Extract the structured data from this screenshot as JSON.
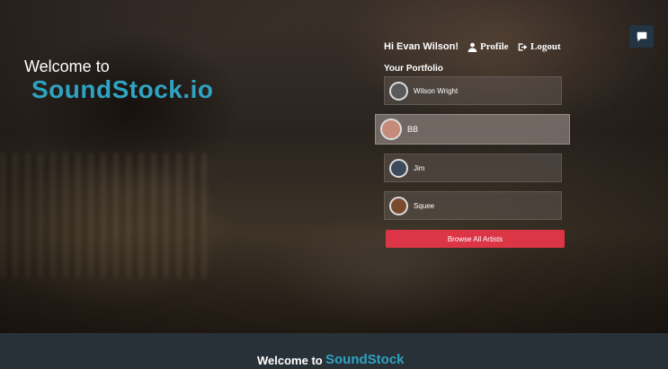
{
  "hero": {
    "welcome": "Welcome to",
    "brand": "SoundStock",
    "brand_tld": ".io"
  },
  "header": {
    "greeting": "Hi Evan Wilson!",
    "profile_label": "Profile",
    "logout_label": "Logout",
    "profile_icon": "user-icon",
    "logout_icon": "sign-out-icon",
    "chat_icon": "chat-icon"
  },
  "portfolio": {
    "label": "Your Portfolio",
    "artists": [
      {
        "name": "Wilson Wright",
        "avatar_color": "#5a5a5a"
      },
      {
        "name": "BB",
        "avatar_color": "#c58b78"
      },
      {
        "name": "Jim",
        "avatar_color": "#3e4a5c"
      },
      {
        "name": "Squee",
        "avatar_color": "#7a4a2e"
      }
    ],
    "browse_label": "Browse All Artists"
  },
  "footer": {
    "welcome": "Welcome to",
    "brand": "SoundStock"
  },
  "colors": {
    "accent": "#2fa3c2",
    "button": "#dc3545",
    "footer_bg": "#283038"
  }
}
